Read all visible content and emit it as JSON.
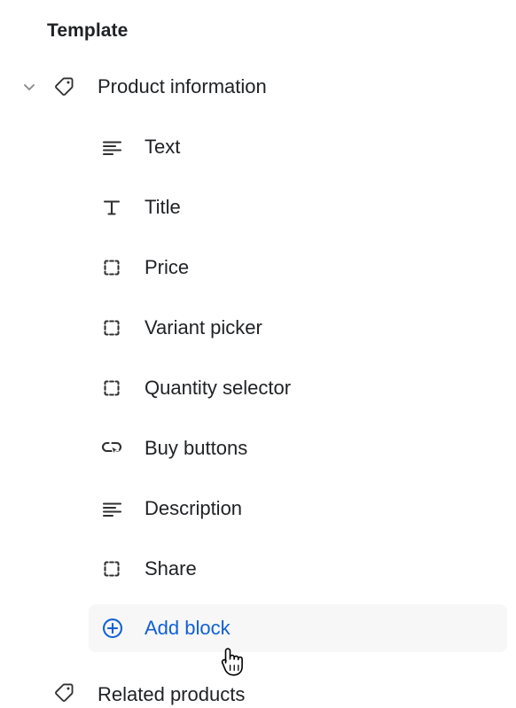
{
  "panel": {
    "title": "Template"
  },
  "sections": [
    {
      "label": "Product information",
      "icon": "tag-icon",
      "expanded": true,
      "chevron": "chevron-down-icon"
    }
  ],
  "blocks": [
    {
      "label": "Text",
      "icon": "text-lines-icon"
    },
    {
      "label": "Title",
      "icon": "title-t-icon"
    },
    {
      "label": "Price",
      "icon": "placeholder-corners-icon"
    },
    {
      "label": "Variant picker",
      "icon": "placeholder-corners-icon"
    },
    {
      "label": "Quantity selector",
      "icon": "placeholder-corners-icon"
    },
    {
      "label": "Buy buttons",
      "icon": "button-cursor-icon"
    },
    {
      "label": "Description",
      "icon": "text-lines-icon"
    },
    {
      "label": "Share",
      "icon": "placeholder-corners-icon"
    }
  ],
  "add_block": {
    "label": "Add block",
    "icon": "circle-plus-icon"
  },
  "bottom_section": {
    "label": "Related products",
    "icon": "tag-icon"
  },
  "cursor": {
    "icon": "pointing-hand-cursor"
  },
  "colors": {
    "text": "#1f2124",
    "link": "#1060d3",
    "highlight_bg": "#f7f7f8",
    "icon": "#303030",
    "chevron": "#8a8a8a",
    "page_bg": "#ffffff"
  }
}
